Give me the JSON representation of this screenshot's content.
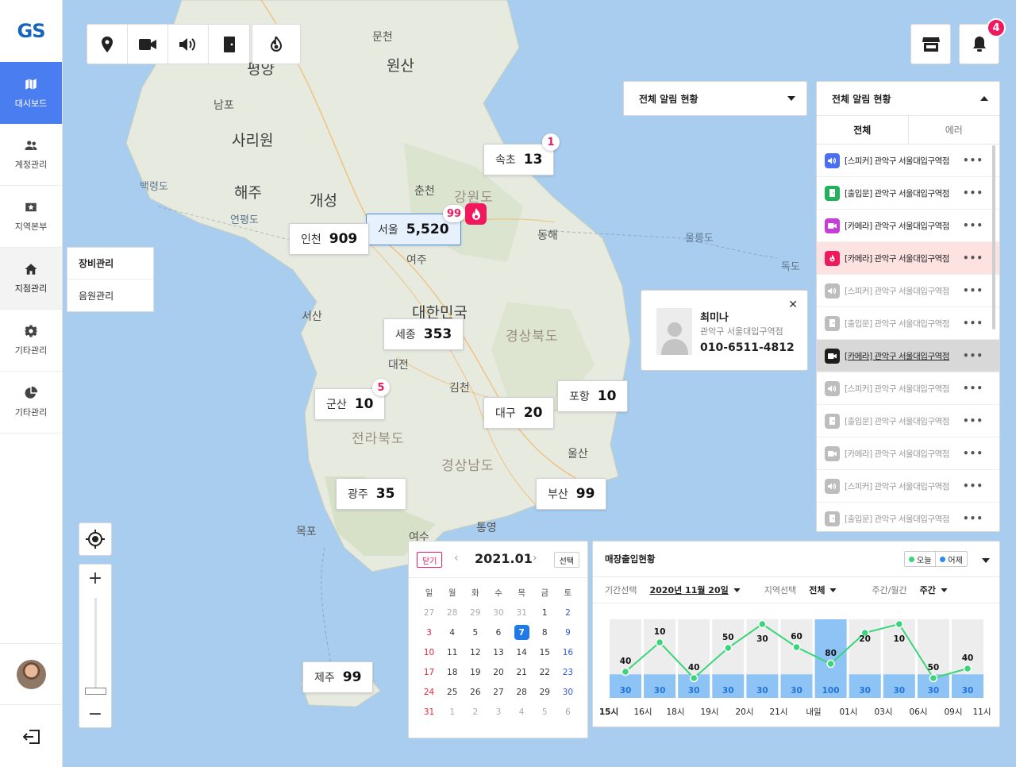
{
  "sidebar": {
    "logo": "GS",
    "items": [
      {
        "label": "대시보드",
        "icon": "map-icon"
      },
      {
        "label": "계정관리",
        "icon": "users-icon"
      },
      {
        "label": "지역본부",
        "icon": "region-icon"
      },
      {
        "label": "지점관리",
        "icon": "home-icon"
      },
      {
        "label": "기타관리",
        "icon": "gear-icon"
      },
      {
        "label": "기타관리",
        "icon": "pie-chart-icon"
      }
    ],
    "submenu": [
      "장비관리",
      "음원관리"
    ]
  },
  "toolbar": {
    "buttons": [
      "location-pin-icon",
      "camera-icon",
      "speaker-icon",
      "door-icon",
      "fire-icon"
    ],
    "notification_count": "4"
  },
  "map": {
    "labels": [
      {
        "t": "문천",
        "k": ""
      },
      {
        "t": "원산",
        "k": "big"
      },
      {
        "t": "평양",
        "k": "big"
      },
      {
        "t": "남포",
        "k": ""
      },
      {
        "t": "사리원",
        "k": "big"
      },
      {
        "t": "해주",
        "k": "big"
      },
      {
        "t": "백령도",
        "k": "sea"
      },
      {
        "t": "개성",
        "k": "big"
      },
      {
        "t": "연평도",
        "k": "sea"
      },
      {
        "t": "춘천",
        "k": ""
      },
      {
        "t": "강원도",
        "k": "region"
      },
      {
        "t": "동해",
        "k": ""
      },
      {
        "t": "울릉도",
        "k": "sea"
      },
      {
        "t": "독도",
        "k": "sea"
      },
      {
        "t": "여주",
        "k": ""
      },
      {
        "t": "서산",
        "k": ""
      },
      {
        "t": "대한민국",
        "k": "big"
      },
      {
        "t": "경상북도",
        "k": "region"
      },
      {
        "t": "대전",
        "k": ""
      },
      {
        "t": "김천",
        "k": ""
      },
      {
        "t": "전라북도",
        "k": "region"
      },
      {
        "t": "경상남도",
        "k": "region"
      },
      {
        "t": "울산",
        "k": ""
      },
      {
        "t": "목포",
        "k": ""
      },
      {
        "t": "여수",
        "k": ""
      },
      {
        "t": "통영",
        "k": ""
      }
    ]
  },
  "cities": [
    {
      "name": "속초",
      "count": "13"
    },
    {
      "name": "서울",
      "count": "5,520"
    },
    {
      "name": "인천",
      "count": "909"
    },
    {
      "name": "세종",
      "count": "353"
    },
    {
      "name": "군산",
      "count": "10"
    },
    {
      "name": "대구",
      "count": "20"
    },
    {
      "name": "포항",
      "count": "10"
    },
    {
      "name": "광주",
      "count": "35"
    },
    {
      "name": "부산",
      "count": "99"
    },
    {
      "name": "제주",
      "count": "99"
    }
  ],
  "badges": {
    "sokcho": "1",
    "seoul": "99",
    "gunsan": "5"
  },
  "person": {
    "name": "최미나",
    "branch": "관악구 서울대입구역점",
    "phone": "010-6511-4812"
  },
  "alerts": {
    "dropdown_label": "전체 알림 현황",
    "panel_title": "전체 알림 현황",
    "tabs": [
      "전체",
      "에러"
    ],
    "rows": [
      {
        "text": "[스피커] 관악구 서울대입구역점",
        "type": "speaker",
        "color": "#4a6ff0",
        "state": ""
      },
      {
        "text": "[출입문] 관악구 서울대입구역점",
        "type": "door",
        "color": "#21b25a",
        "state": ""
      },
      {
        "text": "[카메라] 관악구 서울대입구역점",
        "type": "camera",
        "color": "#c53fd6",
        "state": ""
      },
      {
        "text": "[카메라] 관악구 서울대입구역점",
        "type": "fire",
        "color": "#f0195e",
        "state": "danger"
      },
      {
        "text": "[스피커] 관악구 서울대입구역점",
        "type": "speaker",
        "color": "#bdbdbd",
        "state": "dim"
      },
      {
        "text": "[출입문] 관악구 서울대입구역점",
        "type": "door",
        "color": "#bdbdbd",
        "state": "dim"
      },
      {
        "text": "[카메라] 관악구 서울대입구역점",
        "type": "camera",
        "color": "#1e1e1e",
        "state": "selected"
      },
      {
        "text": "[스피커] 관악구 서울대입구역점",
        "type": "speaker",
        "color": "#bdbdbd",
        "state": "dim"
      },
      {
        "text": "[출입문] 관악구 서울대입구역점",
        "type": "door",
        "color": "#bdbdbd",
        "state": "dim"
      },
      {
        "text": "[카메라] 관악구 서울대입구역점",
        "type": "camera",
        "color": "#bdbdbd",
        "state": "dim"
      },
      {
        "text": "[스피커] 관악구 서울대입구역점",
        "type": "speaker",
        "color": "#bdbdbd",
        "state": "dim"
      },
      {
        "text": "[출입문] 관악구 서울대입구역점",
        "type": "door",
        "color": "#bdbdbd",
        "state": "dim"
      }
    ]
  },
  "calendar": {
    "close_label": "닫기",
    "title": "2021.01",
    "select_label": "선택",
    "weekdays": [
      "일",
      "월",
      "화",
      "수",
      "목",
      "금",
      "토"
    ],
    "days": [
      "27",
      "28",
      "29",
      "30",
      "31",
      "1",
      "2",
      "3",
      "4",
      "5",
      "6",
      "7",
      "8",
      "9",
      "10",
      "11",
      "12",
      "13",
      "14",
      "15",
      "16",
      "17",
      "18",
      "19",
      "20",
      "21",
      "22",
      "23",
      "24",
      "25",
      "26",
      "27",
      "28",
      "29",
      "30",
      "31",
      "1",
      "2",
      "3",
      "4",
      "5",
      "6"
    ],
    "month_start_index": 5,
    "month_end_index": 35,
    "today_index": 11
  },
  "traffic": {
    "title": "매장출입현황",
    "legend": [
      {
        "label": "오늘",
        "color": "#3ad57a"
      },
      {
        "label": "어제",
        "color": "#2d8cf0"
      }
    ],
    "filters": [
      {
        "label": "기간선택",
        "value": "2020년 11월 20일"
      },
      {
        "label": "지역선택",
        "value": "전체"
      },
      {
        "label": "주간/월간",
        "value": "주간"
      }
    ]
  },
  "chart_data": {
    "type": "bar",
    "categories": [
      "15시",
      "16시",
      "18시",
      "19시",
      "20시",
      "21시",
      "내일",
      "01시",
      "03시",
      "06시",
      "09시",
      "11시"
    ],
    "bar_values": [
      30,
      30,
      30,
      30,
      30,
      30,
      100,
      30,
      30,
      30,
      30
    ],
    "line_values": [
      40,
      10,
      40,
      50,
      30,
      60,
      80,
      20,
      10,
      50,
      40
    ],
    "ylim": [
      0,
      100
    ]
  }
}
